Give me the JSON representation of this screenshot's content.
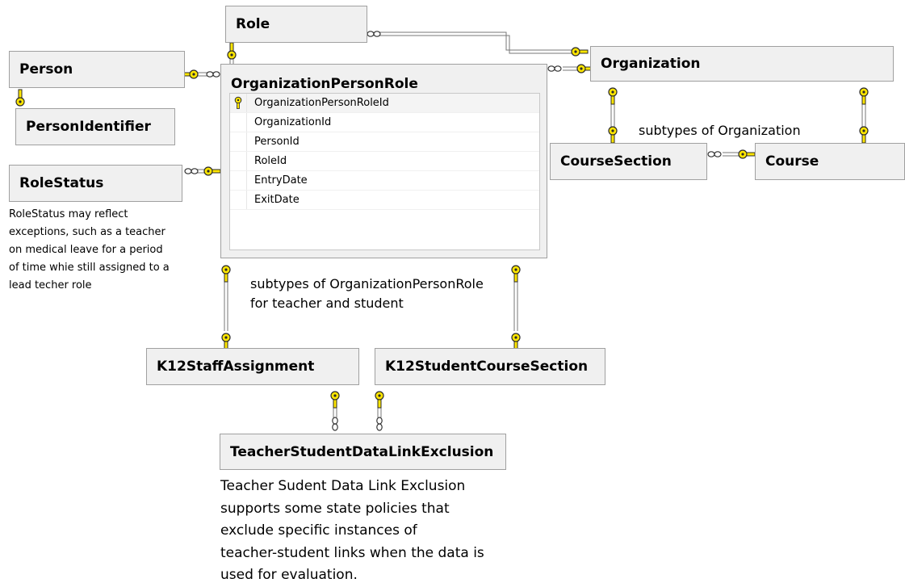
{
  "entities": {
    "role": "Role",
    "person": "Person",
    "person_identifier": "PersonIdentifier",
    "role_status": "RoleStatus",
    "organization": "Organization",
    "course_section": "CourseSection",
    "course": "Course",
    "k12_staff_assignment": "K12StaffAssignment",
    "k12_student_course_section": "K12StudentCourseSection",
    "teacher_student_exclusion": "TeacherStudentDataLinkExclusion"
  },
  "organization_person_role": {
    "title": "OrganizationPersonRole",
    "fields": [
      "OrganizationPersonRoleId",
      "OrganizationId",
      "PersonId",
      "RoleId",
      "EntryDate",
      "ExitDate"
    ]
  },
  "notes": {
    "role_status": [
      "RoleStatus may reflect",
      "exceptions, such as a teacher",
      "on medical leave for a period",
      "of time whie still assigned to a",
      "lead techer role"
    ],
    "organization_subtypes": "subtypes of Organization",
    "opr_subtypes": [
      "subtypes of OrganizationPersonRole",
      "for teacher and student"
    ],
    "exclusion": [
      "Teacher Sudent Data Link Exclusion",
      "supports some state policies that",
      "exclude specific instances of",
      "teacher-student links when the data is",
      "used for evaluation."
    ]
  },
  "colors": {
    "key_fill": "#ffe600",
    "key_outline": "#2a2a2a",
    "line": "#666666",
    "box": "#f0f0f0"
  },
  "icons": [
    "key-icon",
    "primary-key-icon",
    "infinity-icon"
  ]
}
